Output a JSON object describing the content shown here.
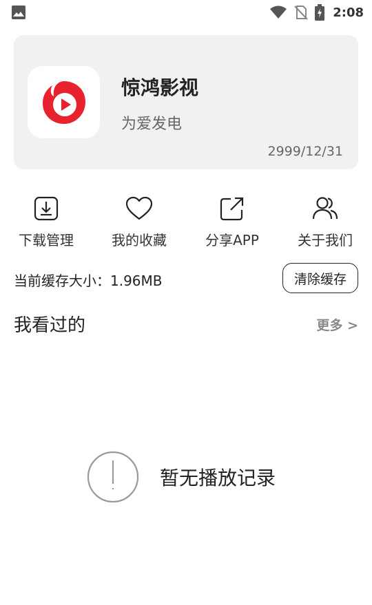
{
  "status_bar": {
    "time": "2:08",
    "icons": [
      "image-notification-icon",
      "wifi-icon",
      "no-sim-icon",
      "battery-charging-icon"
    ]
  },
  "app": {
    "name": "惊鸿影视",
    "slogan": "为爱发电",
    "date": "2999/12/31",
    "logo_color": "#e8232f"
  },
  "actions": [
    {
      "label": "下载管理",
      "icon": "download-icon"
    },
    {
      "label": "我的收藏",
      "icon": "heart-icon"
    },
    {
      "label": "分享APP",
      "icon": "share-icon"
    },
    {
      "label": "关于我们",
      "icon": "users-icon"
    }
  ],
  "cache": {
    "label": "当前缓存大小：1.96MB",
    "clear_button": "清除缓存"
  },
  "history": {
    "title": "我看过的",
    "more": "更多 >",
    "empty_text": "暂无播放记录"
  }
}
